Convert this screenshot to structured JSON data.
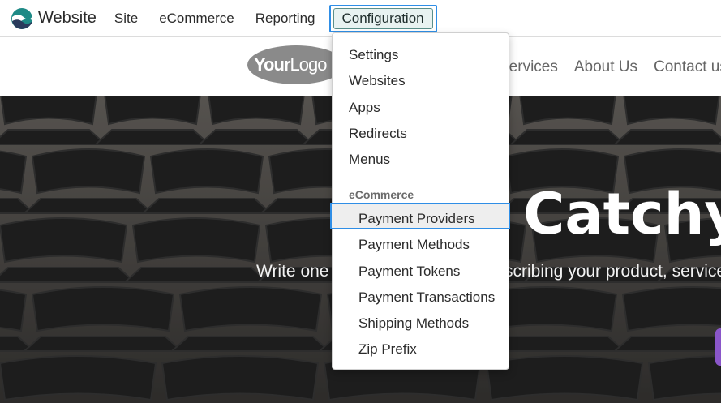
{
  "topbar": {
    "brand": "Website",
    "menu": [
      "Site",
      "eCommerce",
      "Reporting"
    ],
    "active_menu": "Configuration"
  },
  "site": {
    "logo_bold": "Your",
    "logo_thin": "Logo",
    "links": [
      "Services",
      "About Us",
      "Contact us"
    ]
  },
  "hero": {
    "title": "Catchy",
    "subtitle_left": "Write one",
    "subtitle_right": "scribing your product, services"
  },
  "dropdown": {
    "items": [
      "Settings",
      "Websites",
      "Apps",
      "Redirects",
      "Menus"
    ],
    "section": "eCommerce",
    "ecommerce_items": [
      "Payment Providers",
      "Payment Methods",
      "Payment Tokens",
      "Payment Transactions",
      "Shipping Methods",
      "Zip Prefix"
    ]
  },
  "colors": {
    "highlight_border": "#2f8ee6",
    "active_bg": "#e8f2f1",
    "hero_button": "#8a56c9"
  }
}
